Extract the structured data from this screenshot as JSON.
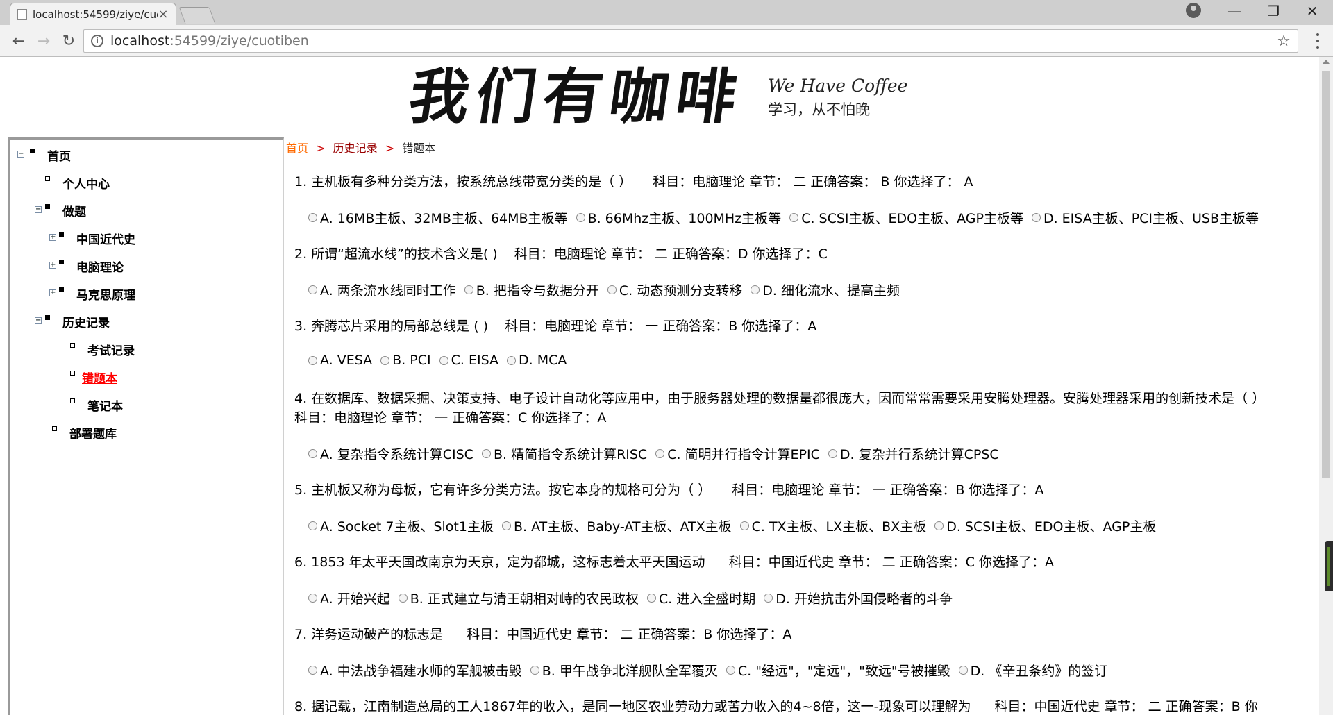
{
  "browser": {
    "tab_title": "localhost:54599/ziye/cuotiben",
    "url_host": "localhost",
    "url_path": ":54599/ziye/cuotiben",
    "icons": [
      "back-icon",
      "forward-icon",
      "reload-icon",
      "info-icon",
      "star-icon",
      "menu-icon",
      "profile-icon"
    ]
  },
  "banner": {
    "title": "我们有咖啡",
    "subtitle_en": "We Have Coffee",
    "subtitle_cn": "学习，从不怕晚"
  },
  "sidebar": {
    "items": [
      {
        "label": "首页",
        "level": 0,
        "toggle": "⊟"
      },
      {
        "label": "个人中心",
        "level": 1
      },
      {
        "label": "做题",
        "level": 1,
        "toggle": "⊟"
      },
      {
        "label": "中国近代史",
        "level": 2,
        "toggle": "⊞"
      },
      {
        "label": "电脑理论",
        "level": 2,
        "toggle": "⊞"
      },
      {
        "label": "马克思原理",
        "level": 2,
        "toggle": "⊞"
      },
      {
        "label": "历史记录",
        "level": 1,
        "toggle": "⊟"
      },
      {
        "label": "考试记录",
        "level": 2
      },
      {
        "label": "错题本",
        "level": 2,
        "active": true
      },
      {
        "label": "笔记本",
        "level": 2
      },
      {
        "label": "部署题库",
        "level": 1
      }
    ]
  },
  "breadcrumb": {
    "home": "首页",
    "history": "历史记录",
    "current": "错题本",
    "sep": ">"
  },
  "questions": [
    {
      "stem": "1. 主机板有多种分类方法，按系统总线带宽分类的是（ ）",
      "meta": "科目：电脑理论 章节： 二 正确答案： B 你选择了： A",
      "options": [
        "A. 16MB主板、32MB主板、64MB主板等",
        "B. 66Mhz主板、100MHz主板等",
        "C. SCSI主板、EDO主板、AGP主板等",
        "D. EISA主板、PCI主板、USB主板等"
      ]
    },
    {
      "stem": "2. 所谓“超流水线”的技术含义是( )",
      "meta": "科目：电脑理论 章节： 二 正确答案：D 你选择了：C",
      "options": [
        "A. 两条流水线同时工作",
        "B. 把指令与数据分开",
        "C. 动态预测分支转移",
        "D. 细化流水、提高主频"
      ]
    },
    {
      "stem": "3. 奔腾芯片采用的局部总线是 ( )",
      "meta": "科目：电脑理论 章节： 一 正确答案：B 你选择了：A",
      "options": [
        "A. VESA",
        "B. PCI",
        "C. EISA",
        "D. MCA"
      ]
    },
    {
      "stem": "4. 在数据库、数据采掘、决策支持、电子设计自动化等应用中，由于服务器处理的数据量都很庞大，因而常常需要采用安腾处理器。安腾处理器采用的创新技术是（ ）",
      "meta": "科目：电脑理论 章节： 一 正确答案：C 你选择了：A",
      "options": [
        "A. 复杂指令系统计算CISC",
        "B. 精简指令系统计算RISC",
        "C. 简明并行指令计算EPIC",
        "D. 复杂并行系统计算CPSC"
      ]
    },
    {
      "stem": "5. 主机板又称为母板，它有许多分类方法。按它本身的规格可分为（ ）",
      "meta": "科目：电脑理论 章节： 一 正确答案：B 你选择了：A",
      "options": [
        "A. Socket 7主板、Slot1主板",
        "B. AT主板、Baby-AT主板、ATX主板",
        "C. TX主板、LX主板、BX主板",
        "D. SCSI主板、EDO主板、AGP主板"
      ]
    },
    {
      "stem": "6. 1853 年太平天国改南京为天京，定为都城，这标志着太平天国运动",
      "meta": "科目：中国近代史 章节： 二 正确答案：C 你选择了：A",
      "options": [
        "A. 开始兴起",
        "B. 正式建立与清王朝相对峙的农民政权",
        "C. 进入全盛时期",
        "D. 开始抗击外国侵略者的斗争"
      ]
    },
    {
      "stem": "7. 洋务运动破产的标志是",
      "meta": "科目：中国近代史 章节： 二 正确答案：B 你选择了：A",
      "options": [
        "A. 中法战争福建水师的军舰被击毁",
        "B. 甲午战争北洋舰队全军覆灭",
        "C. \"经远\"，\"定远\"，\"致远\"号被摧毁",
        "D. 《辛丑条约》的签订"
      ]
    },
    {
      "stem": "8. 据记载，江南制造总局的工人1867年的收入，是同一地区农业劳动力或苦力收入的4~8倍，这一-现象可以理解为",
      "meta": "科目：中国近代史 章节： 二 正确答案：B 你",
      "options": []
    }
  ]
}
